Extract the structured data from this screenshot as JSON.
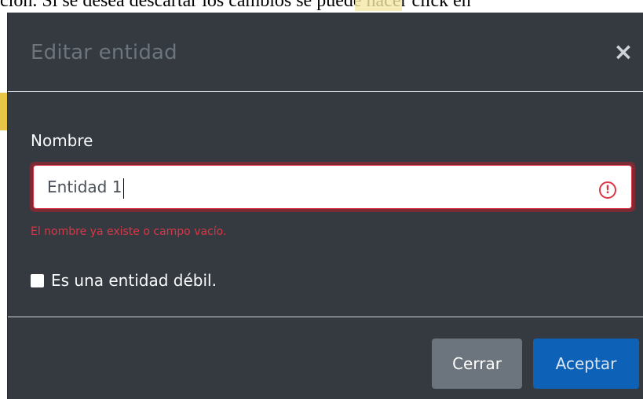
{
  "background": {
    "doc_text": "ción.  Si se desea descartar los cambios se puede hacer click en"
  },
  "modal": {
    "title": "Editar entidad",
    "close_symbol": "×",
    "field": {
      "label": "Nombre",
      "value": "Entidad 1",
      "error_icon": "!",
      "error_message": "El nombre ya existe o campo vacío."
    },
    "checkbox": {
      "label": "Es una entidad débil.",
      "checked": false
    },
    "footer": {
      "close_label": "Cerrar",
      "accept_label": "Aceptar"
    }
  },
  "colors": {
    "modal_bg": "#343a40",
    "error": "#dc3545",
    "primary": "#0d62b8",
    "secondary": "#6c757d"
  },
  "icons": {
    "close": "close-icon",
    "error": "exclamation-circle-icon"
  }
}
